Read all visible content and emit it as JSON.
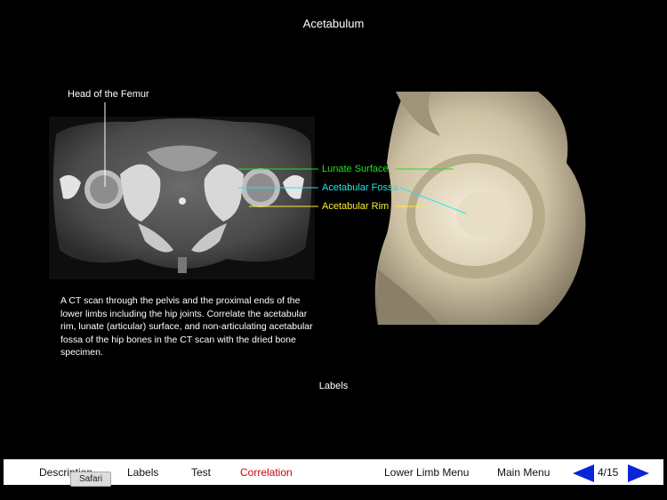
{
  "header": {
    "title": "Acetabulum"
  },
  "figure": {
    "femur_label": "Head of the Femur",
    "callouts": {
      "lunate": {
        "text": "Lunate Surface",
        "color": "#22e022"
      },
      "fossa": {
        "text": "Acetabular Fossa",
        "color": "#1fe6ec"
      },
      "rim": {
        "text": "Acetabular Rim",
        "color": "#ffee33"
      }
    }
  },
  "description": "A CT scan through the pelvis and the proximal ends of the lower limbs including the hip joints. Correlate the acetabular rim, lunate (articular) surface, and non-articulating acetabular fossa of the hip bones in the CT scan with the dried bone specimen.",
  "labels_toggle": "Labels",
  "toolbar": {
    "description": "Description",
    "labels": "Labels",
    "test": "Test",
    "correlation": "Correlation",
    "lower_limb_menu": "Lower Limb Menu",
    "main_menu": "Main Menu",
    "page": "4/15",
    "prev_icon": "left-arrow-icon",
    "next_icon": "right-arrow-icon",
    "accent": "#0a24d8",
    "active_color": "#d00000"
  },
  "tooltip": "Safari"
}
